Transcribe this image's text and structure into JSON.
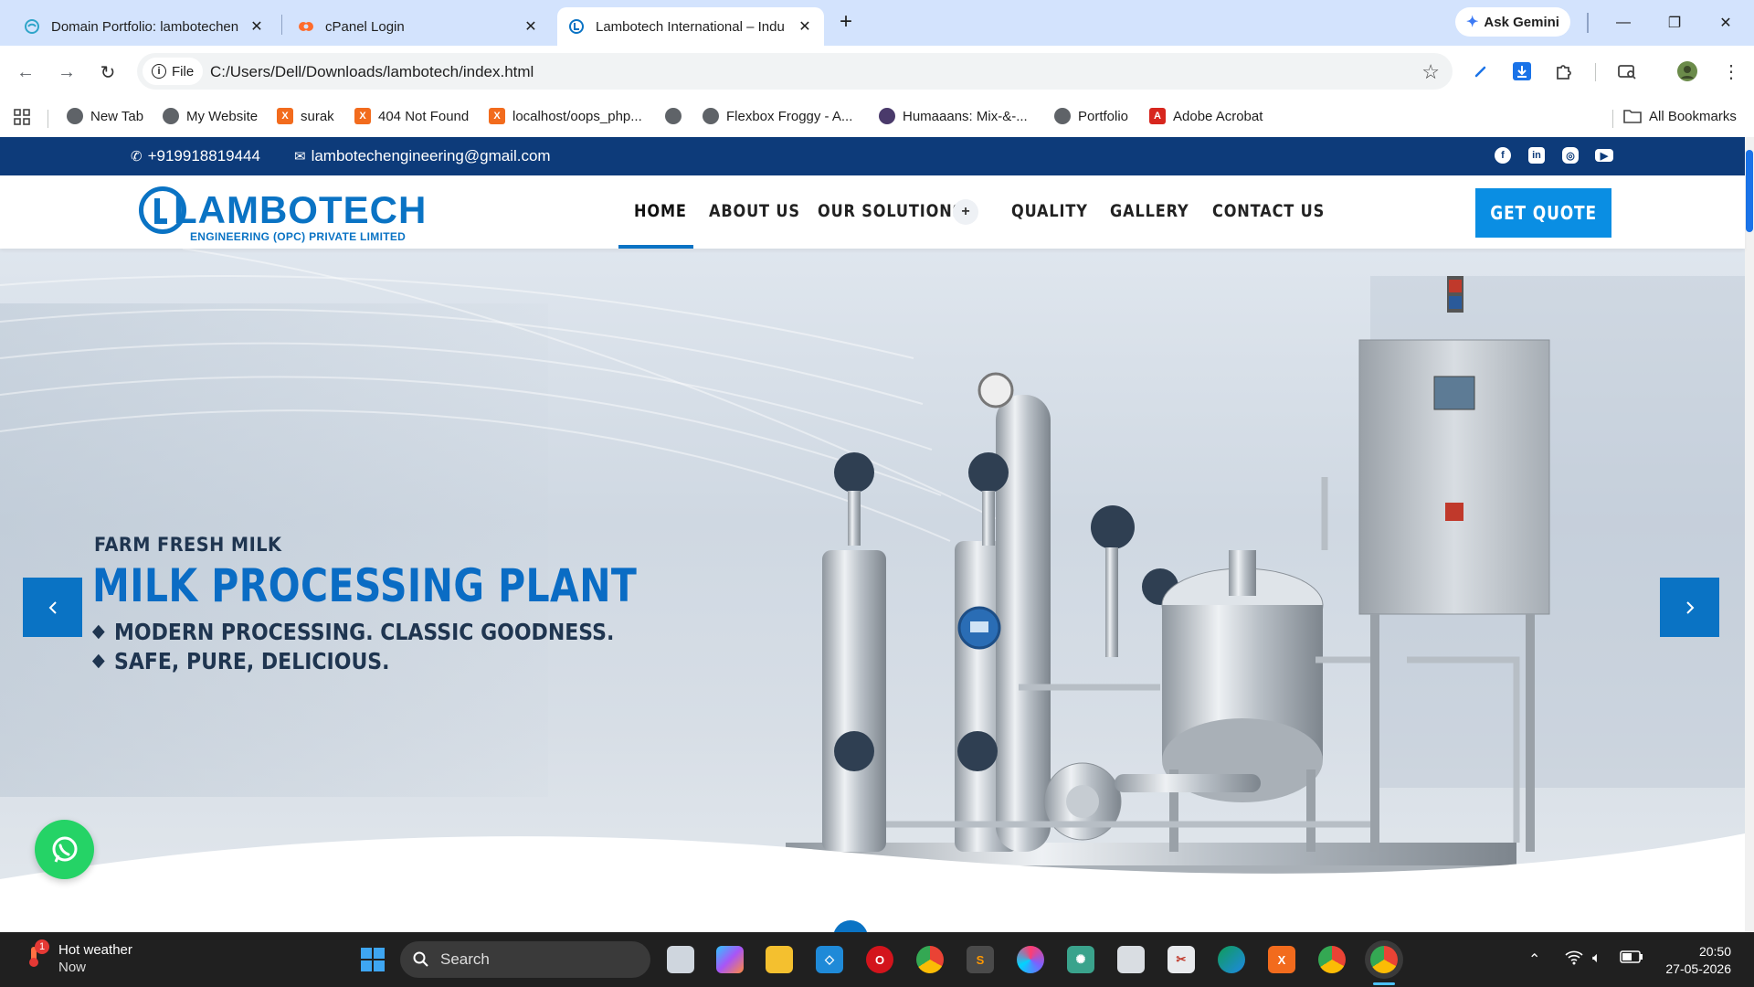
{
  "browser": {
    "tabs": [
      {
        "title": "Domain Portfolio: lambotechen",
        "active": false
      },
      {
        "title": "cPanel Login",
        "active": false
      },
      {
        "title": "Lambotech International – Indu",
        "active": true
      }
    ],
    "ask_gemini": "Ask Gemini",
    "file_chip": "File",
    "url": "C:/Users/Dell/Downloads/lambotech/index.html",
    "bookmarks": [
      "New Tab",
      "My Website",
      "surak",
      "404 Not Found",
      "localhost/oops_php...",
      "Flexbox Froggy - A...",
      "Humaaans: Mix-&-...",
      "Portfolio",
      "Adobe Acrobat"
    ],
    "all_bookmarks": "All Bookmarks"
  },
  "site": {
    "phone": "+919918819444",
    "email": "lambotechengineering@gmail.com",
    "logo_name": "LAMBOTECH",
    "logo_sub": "ENGINEERING (OPC) PRIVATE LIMITED",
    "nav": [
      "HOME",
      "ABOUT US",
      "OUR SOLUTIONS",
      "QUALITY",
      "GALLERY",
      "CONTACT US"
    ],
    "nav_active": "HOME",
    "get_quote": "GET QUOTE",
    "hero": {
      "kicker": "FARM FRESH MILK",
      "title": "MILK PROCESSING PLANT",
      "bullets": [
        "MODERN PROCESSING. CLASSIC GOODNESS.",
        "SAFE, PURE, DELICIOUS."
      ]
    }
  },
  "taskbar": {
    "weather_title": "Hot weather",
    "weather_sub": "Now",
    "weather_badge": "1",
    "search_placeholder": "Search",
    "time": "20:50",
    "date": "27-05-2026"
  },
  "colors": {
    "brand_blue": "#0a73c4",
    "topbar_navy": "#0d3b7a",
    "quote_blue": "#0a8ee3",
    "whatsapp_green": "#25d366"
  }
}
